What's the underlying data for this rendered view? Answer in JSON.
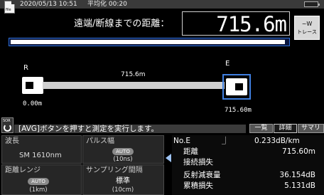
{
  "status_bar": {
    "file_icon_label": "file",
    "datetime": "2020/05/13 10:51",
    "averaging": "平均化 00:20",
    "battery_icon": "battery-icon"
  },
  "distance": {
    "label": "遠端/断線までの距離：",
    "value": "715.6m"
  },
  "trace_button": {
    "symbol": "~W",
    "label": "トレース"
  },
  "overview_bar": {
    "fill_fraction": 0.99
  },
  "link_map": {
    "start_label": "R",
    "end_label": "E",
    "span_length": "715.6m",
    "start_distance": "0.00m",
    "end_distance": "715.60m"
  },
  "message": {
    "icon_label": "SOR",
    "text": "[AVG]ボタンを押すと測定を実行します。"
  },
  "tabs": [
    {
      "label": "一覧",
      "active": false
    },
    {
      "label": "詳細",
      "active": true
    },
    {
      "label": "サマリ",
      "active": false
    }
  ],
  "settings": {
    "wavelength": {
      "label": "波長",
      "value": "SM 1610nm"
    },
    "pulse_width": {
      "label": "パルス幅",
      "mode": "AUTO",
      "value": "(10ns)"
    },
    "distance_range": {
      "label": "距離レンジ",
      "mode": "AUTO",
      "value": "(1km)"
    },
    "sampling_interval": {
      "label": "サンプリング間隔",
      "mode": "標準",
      "value": "(10cm)"
    }
  },
  "event": {
    "number": "No.E",
    "symbol": "⏌",
    "loss_per_km": "0.233dB/km",
    "rows": [
      {
        "key": "距離",
        "value": "715.60m"
      },
      {
        "key": "接続損失",
        "value": ""
      },
      {
        "key": "反射減衰量",
        "value": "36.154dB"
      },
      {
        "key": "累積損失",
        "value": "5.131dB"
      }
    ]
  },
  "colors": {
    "accent_blue": "#3f7fe0",
    "panel_bg": "#262626",
    "bar_bg": "#3a3a3a"
  }
}
